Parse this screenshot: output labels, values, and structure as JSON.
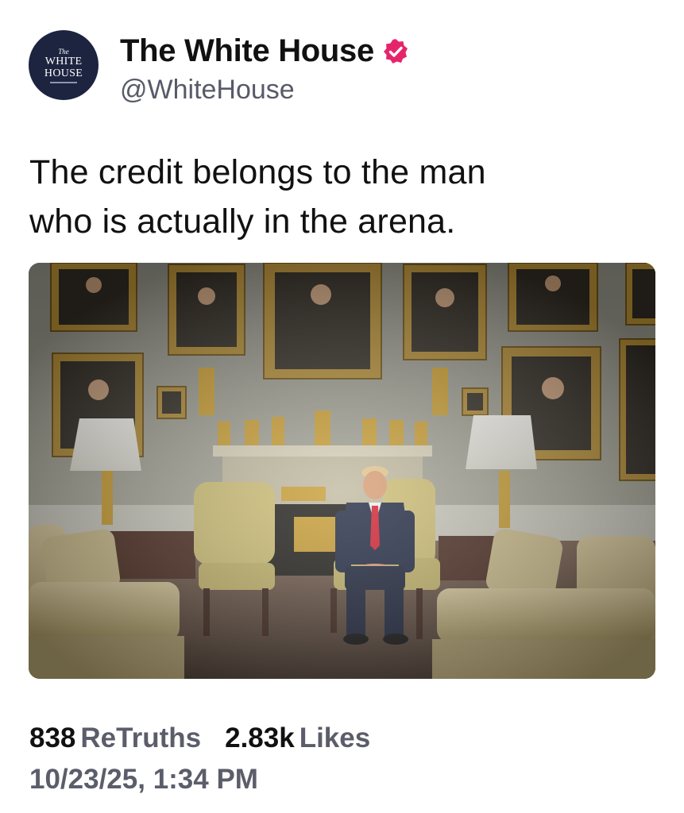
{
  "post": {
    "avatar": {
      "line1": "The",
      "line2": "WHITE",
      "line3": "HOUSE"
    },
    "display_name": "The White House",
    "handle": "@WhiteHouse",
    "text_line1": "The credit belongs to the man",
    "text_line2": "who is actually in the arena.",
    "stats": {
      "retruths_count": "838",
      "retruths_label": "ReTruths",
      "likes_count": "2.83k",
      "likes_label": "Likes"
    },
    "timestamp": "10/23/25, 1:34 PM"
  },
  "colors": {
    "verified_badge": "#e5256b",
    "avatar_bg": "#1d2440",
    "secondary_text": "#5b5d6a"
  },
  "icons": [
    "verified-badge-icon"
  ]
}
